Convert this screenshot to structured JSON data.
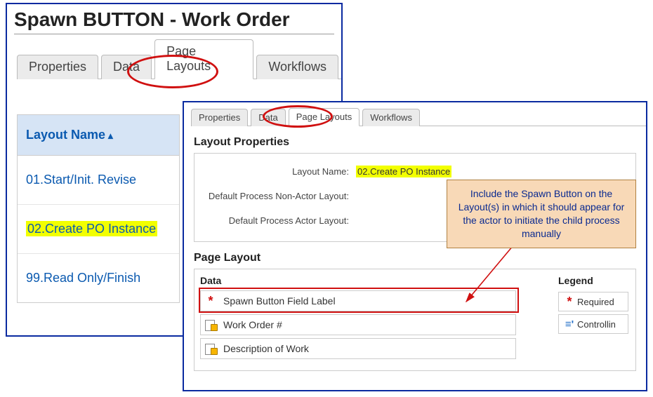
{
  "outer": {
    "title": "Spawn BUTTON - Work Order",
    "tabs": [
      "Properties",
      "Data",
      "Page Layouts",
      "Workflows"
    ],
    "active_tab": 2,
    "layout_header": "Layout Name",
    "layouts": [
      "01.Start/Init. Revise",
      "02.Create PO Instance",
      "99.Read Only/Finish"
    ],
    "highlighted_layout_index": 1
  },
  "inner": {
    "tabs": [
      "Properties",
      "Data",
      "Page Layouts",
      "Workflows"
    ],
    "active_tab": 2,
    "section_properties_title": "Layout Properties",
    "props": {
      "layout_name_label": "Layout Name:",
      "layout_name_value": "02.Create PO Instance",
      "nonactor_label": "Default Process Non-Actor Layout:",
      "nonactor_value": "",
      "actor_label": "Default Process Actor Layout:",
      "actor_value": ""
    },
    "section_page_layout_title": "Page Layout",
    "data_header": "Data",
    "fields": [
      {
        "icon": "required",
        "label": "Spawn Button Field Label"
      },
      {
        "icon": "locked",
        "label": "Work Order #"
      },
      {
        "icon": "locked",
        "label": "Description of Work"
      }
    ],
    "legend_header": "Legend",
    "legend": [
      {
        "icon": "required",
        "label": "Required"
      },
      {
        "icon": "controlling",
        "label": "Controllin"
      }
    ]
  },
  "callout_text": "Include the Spawn Button on the Layout(s) in which it should appear for the actor to initiate the child process manually"
}
